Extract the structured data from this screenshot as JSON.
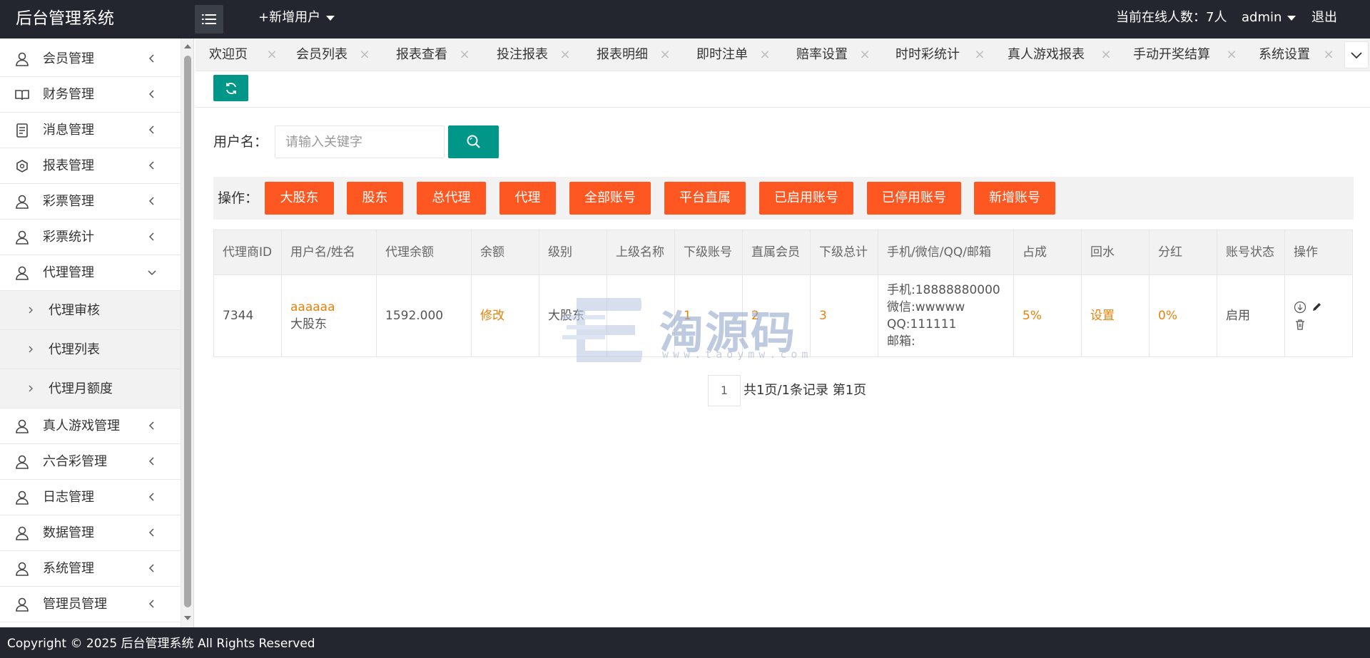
{
  "header": {
    "logo": "后台管理系统",
    "add_user": "+新增用户",
    "online_count": "当前在线人数：7人",
    "admin": "admin",
    "logout": "退出"
  },
  "sidebar": {
    "items": [
      {
        "label": "会员管理",
        "icon": "user-icon"
      },
      {
        "label": "财务管理",
        "icon": "book-icon"
      },
      {
        "label": "消息管理",
        "icon": "message-icon"
      },
      {
        "label": "报表管理",
        "icon": "report-icon"
      },
      {
        "label": "彩票管理",
        "icon": "user-icon"
      },
      {
        "label": "彩票统计",
        "icon": "user-icon"
      },
      {
        "label": "代理管理",
        "icon": "user-icon",
        "expanded": true
      },
      {
        "label": "真人游戏管理",
        "icon": "user-icon"
      },
      {
        "label": "六合彩管理",
        "icon": "user-icon"
      },
      {
        "label": "日志管理",
        "icon": "user-icon"
      },
      {
        "label": "数据管理",
        "icon": "user-icon"
      },
      {
        "label": "系统管理",
        "icon": "user-icon"
      },
      {
        "label": "管理员管理",
        "icon": "user-icon"
      }
    ],
    "sub_items": [
      "代理审核",
      "代理列表",
      "代理月额度"
    ]
  },
  "tabs": [
    "欢迎页",
    "会员列表",
    "报表查看",
    "投注报表",
    "报表明细",
    "即时注单",
    "赔率设置",
    "时时彩统计",
    "真人游戏报表",
    "手动开奖结算",
    "系统设置"
  ],
  "search": {
    "label": "用户名：",
    "placeholder": "请输入关键字"
  },
  "ops": {
    "label": "操作：",
    "buttons": [
      "大股东",
      "股东",
      "总代理",
      "代理",
      "全部账号",
      "平台直属",
      "已启用账号",
      "已停用账号",
      "新增账号"
    ]
  },
  "table": {
    "headers": [
      "代理商ID",
      "用户名/姓名",
      "代理余额",
      "余额",
      "级别",
      "上级名称",
      "下级账号",
      "直属会员",
      "下级总计",
      "手机/微信/QQ/邮箱",
      "占成",
      "回水",
      "分红",
      "账号状态",
      "操作"
    ],
    "row": {
      "id": "7344",
      "username": "aaaaaa",
      "name": "大股东",
      "agent_balance": "1592.000",
      "balance_action": "修改",
      "level": "大股东",
      "parent": "",
      "sub_accounts": "1",
      "direct_members": "2",
      "sub_total": "3",
      "phone": "手机:18888880000",
      "wechat": "微信:wwwww",
      "qq": "QQ:111111",
      "email": "邮箱:",
      "share": "5%",
      "rebate": "设置",
      "dividend": "0%",
      "status": "启用"
    }
  },
  "watermark": {
    "text": "淘源码",
    "url": "www.taoymw.com"
  },
  "pagination": {
    "current": "1",
    "info": "共1页/1条记录 第1页"
  },
  "footer": {
    "copyright": "Copyright © 2025 后台管理系统 All Rights Reserved"
  },
  "colors": {
    "header_bg": "#23262e",
    "accent": "#009688",
    "op_button": "#ff5722",
    "link_orange": "#e6830a"
  }
}
